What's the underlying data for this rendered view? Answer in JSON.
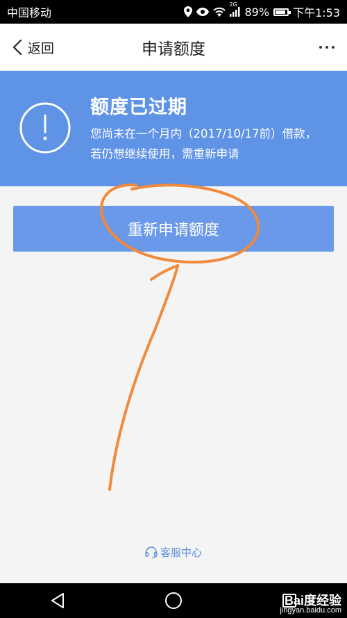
{
  "status_bar": {
    "carrier": "中国移动",
    "network": "2G",
    "battery": "89%",
    "time": "下午1:53"
  },
  "nav": {
    "back_label": "返回",
    "title": "申请额度"
  },
  "banner": {
    "title": "额度已过期",
    "description": "您尚未在一个月内（2017/10/17前）借款，若仍想继续使用，需重新申请",
    "icon": "exclamation-circle-icon",
    "color": "#5e93e6"
  },
  "action": {
    "reapply_label": "重新申请额度",
    "color": "#6b99e9"
  },
  "footer": {
    "service_label": "客服中心",
    "service_icon": "headset-icon"
  },
  "watermark": {
    "brand": "Bai度经验",
    "url": "jingyan.baidu.com"
  }
}
